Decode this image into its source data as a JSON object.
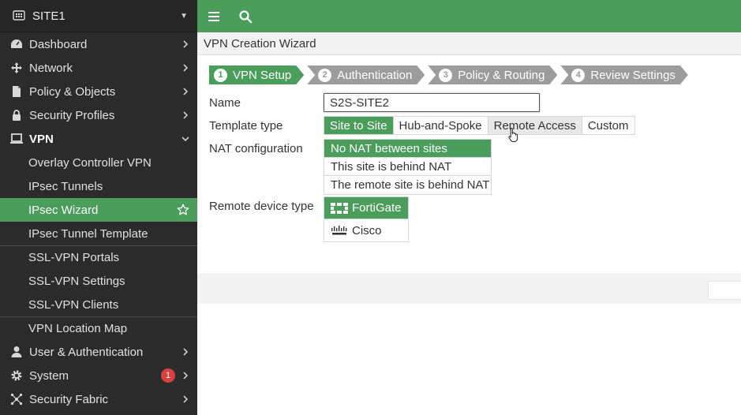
{
  "sidebar": {
    "device": "SITE1",
    "items": [
      {
        "label": "Dashboard",
        "icon": "dashboard-icon"
      },
      {
        "label": "Network",
        "icon": "network-icon"
      },
      {
        "label": "Policy & Objects",
        "icon": "policy-icon"
      },
      {
        "label": "Security Profiles",
        "icon": "lock-icon"
      },
      {
        "label": "VPN",
        "icon": "laptop-icon"
      }
    ],
    "vpn_sub": [
      {
        "label": "Overlay Controller VPN"
      },
      {
        "label": "IPsec Tunnels"
      },
      {
        "label": "IPsec Wizard"
      },
      {
        "label": "IPsec Tunnel Template"
      },
      {
        "label": "SSL-VPN Portals"
      },
      {
        "label": "SSL-VPN Settings"
      },
      {
        "label": "SSL-VPN Clients"
      },
      {
        "label": "VPN Location Map"
      }
    ],
    "items_bottom": [
      {
        "label": "User & Authentication",
        "icon": "user-icon"
      },
      {
        "label": "System",
        "icon": "gear-icon",
        "badge": "1"
      },
      {
        "label": "Security Fabric",
        "icon": "fabric-icon"
      }
    ]
  },
  "page_title": "VPN Creation Wizard",
  "steps": [
    {
      "num": "1",
      "label": "VPN Setup"
    },
    {
      "num": "2",
      "label": "Authentication"
    },
    {
      "num": "3",
      "label": "Policy & Routing"
    },
    {
      "num": "4",
      "label": "Review Settings"
    }
  ],
  "form": {
    "name_label": "Name",
    "name_value": "S2S-SITE2",
    "template_label": "Template type",
    "template_options": [
      "Site to Site",
      "Hub-and-Spoke",
      "Remote Access",
      "Custom"
    ],
    "nat_label": "NAT configuration",
    "nat_options": [
      "No NAT between sites",
      "This site is behind NAT",
      "The remote site is behind NAT"
    ],
    "device_label": "Remote device type",
    "device_options": [
      "FortiGate",
      "Cisco"
    ]
  },
  "colors": {
    "accent": "#4a9d5b",
    "sidebar": "#2b2b2b",
    "badge": "#d9413e"
  }
}
